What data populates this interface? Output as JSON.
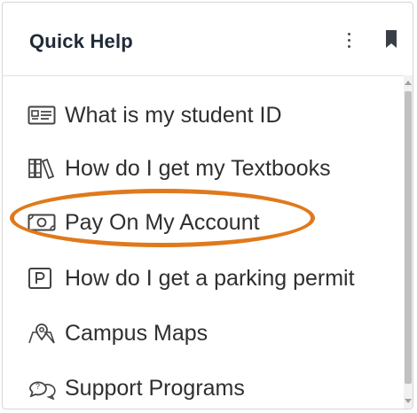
{
  "panel": {
    "title": "Quick Help",
    "menu_icon": "more-vertical-icon",
    "bookmark_icon": "bookmark-icon"
  },
  "items": [
    {
      "label": "What is my student ID",
      "icon": "id-card-icon"
    },
    {
      "label": "How do I get my Textbooks",
      "icon": "books-icon"
    },
    {
      "label": "Pay On My Account",
      "icon": "money-icon"
    },
    {
      "label": "How do I get a parking permit",
      "icon": "parking-icon"
    },
    {
      "label": "Campus Maps",
      "icon": "map-pin-icon"
    },
    {
      "label": "Support Programs",
      "icon": "chat-help-icon"
    }
  ],
  "colors": {
    "highlight_ring": "#e0791c",
    "title_text": "#1f2a36",
    "item_text": "#2f2f2f"
  }
}
